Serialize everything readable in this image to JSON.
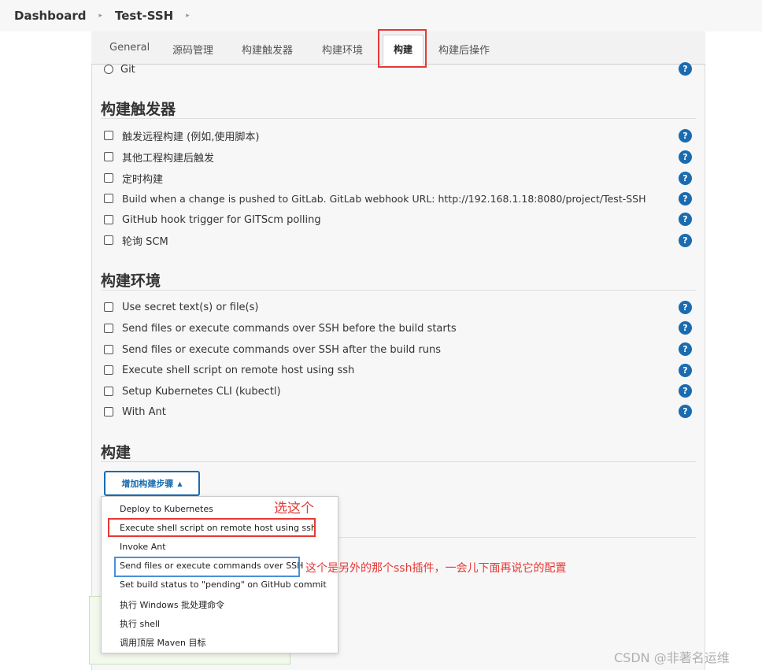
{
  "breadcrumb": {
    "items": [
      "Dashboard",
      "Test-SSH"
    ],
    "separator": "▸"
  },
  "tabs": [
    "General",
    "源码管理",
    "构建触发器",
    "构建环境",
    "构建",
    "构建后操作"
  ],
  "active_tab": "构建",
  "scm": {
    "git_label": "Git"
  },
  "triggers": {
    "title": "构建触发器",
    "items": [
      "触发远程构建 (例如,使用脚本)",
      "其他工程构建后触发",
      "定时构建",
      "Build when a change is pushed to GitLab. GitLab webhook URL: http://192.168.1.18:8080/project/Test-SSH",
      "GitHub hook trigger for GITScm polling",
      "轮询 SCM"
    ]
  },
  "build_env": {
    "title": "构建环境",
    "items": [
      "Use secret text(s) or file(s)",
      "Send files or execute commands over SSH before the build starts",
      "Send files or execute commands over SSH after the build runs",
      "Execute shell script on remote host using ssh",
      "Setup Kubernetes CLI (kubectl)",
      "With Ant"
    ]
  },
  "build": {
    "title": "构建",
    "add_step_label": "增加构建步骤",
    "menu": [
      "Deploy to Kubernetes",
      "Execute shell script on remote host using ssh",
      "Invoke Ant",
      "Send files or execute commands over SSH",
      "Set build status to \"pending\" on GitHub commit",
      "执行 Windows 批处理命令",
      "执行 shell",
      "调用顶层 Maven 目标"
    ]
  },
  "annotations": {
    "choose_this": "选这个",
    "other_plugin": "这个是另外的那个ssh插件，一会儿下面再说它的配置"
  },
  "help_glyph": "?",
  "watermark": "CSDN @非著名运维",
  "colors": {
    "accent": "#1a6bb0",
    "highlight_red": "#e53935",
    "highlight_blue": "#4a90d9"
  }
}
